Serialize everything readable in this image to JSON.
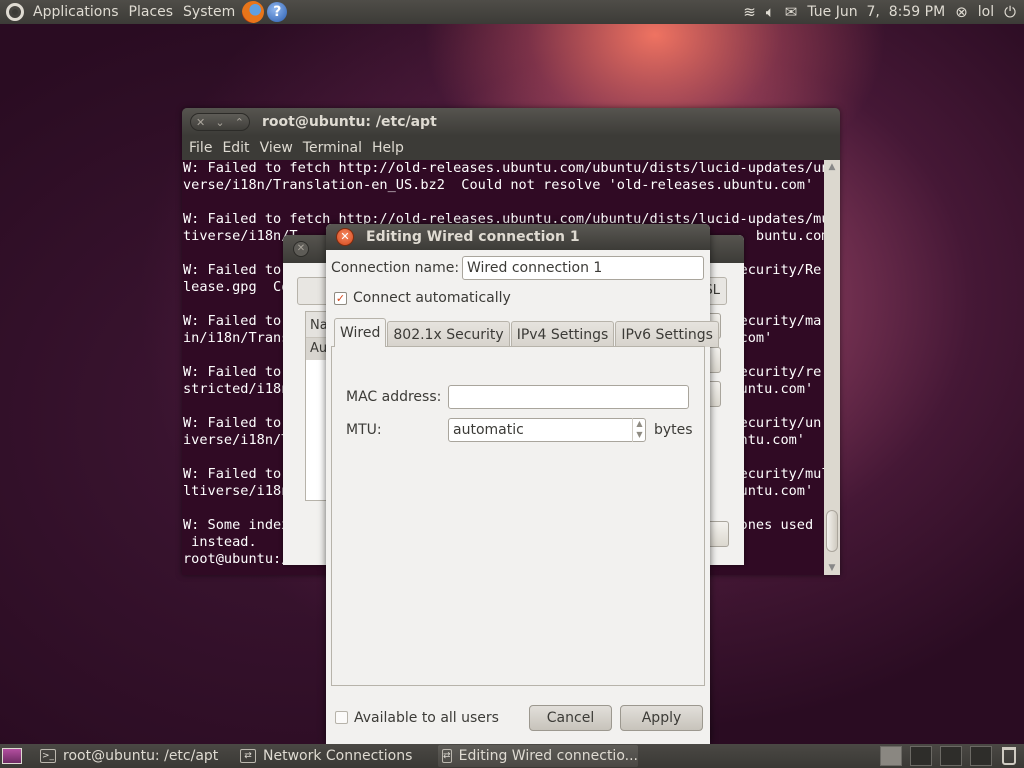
{
  "top_panel": {
    "menus": [
      "Applications",
      "Places",
      "System"
    ],
    "clock": "Tue Jun  7,  8:59 PM",
    "user": "lol"
  },
  "terminal": {
    "title": "root@ubuntu: /etc/apt",
    "menu": [
      "File",
      "Edit",
      "View",
      "Terminal",
      "Help"
    ],
    "lines": [
      "W: Failed to fetch http://old-releases.ubuntu.com/ubuntu/dists/lucid-updates/uni",
      "verse/i18n/Translation-en_US.bz2  Could not resolve 'old-releases.ubuntu.com'",
      "",
      "W: Failed to fetch http://old-releases.ubuntu.com/ubuntu/dists/lucid-updates/mul",
      "tiverse/i18n/T                                                        buntu.com'",
      "",
      "W: Failed to                                                       security/Re",
      "lease.gpg  Co",
      "",
      "W: Failed to                                                       security/ma",
      "in/i18n/Trans                                                      .com'",
      "",
      "W: Failed to                                                       security/re",
      "stricted/i18n                                                      buntu.com'",
      "",
      "W: Failed to                                                       security/un",
      "iverse/i18n/T                                                      untu.com'",
      "",
      "W: Failed to                                                       security/mul",
      "ltiverse/i18n                                                      buntu.com'",
      "",
      "W: Some index                                                       ones used",
      " instead.",
      "root@ubuntu:/"
    ]
  },
  "network_connections": {
    "title": "Network Connections",
    "tab_fragment": "SL",
    "list_header": "Na",
    "list_row": "Au"
  },
  "dialog": {
    "title": "Editing Wired connection 1",
    "connection_name_label": "Connection name:",
    "connection_name_value": "Wired connection 1",
    "connect_auto_label": "Connect automatically",
    "tabs": [
      "Wired",
      "802.1x Security",
      "IPv4 Settings",
      "IPv6 Settings"
    ],
    "mac_label": "MAC address:",
    "mac_value": "",
    "mtu_label": "MTU:",
    "mtu_value": "automatic",
    "mtu_unit": "bytes",
    "all_users_label": "Available to all users",
    "cancel_label": "Cancel",
    "apply_label": "Apply"
  },
  "taskbar": {
    "tasks": [
      "root@ubuntu: /etc/apt",
      "Network Connections",
      "Editing Wired connectio..."
    ]
  }
}
